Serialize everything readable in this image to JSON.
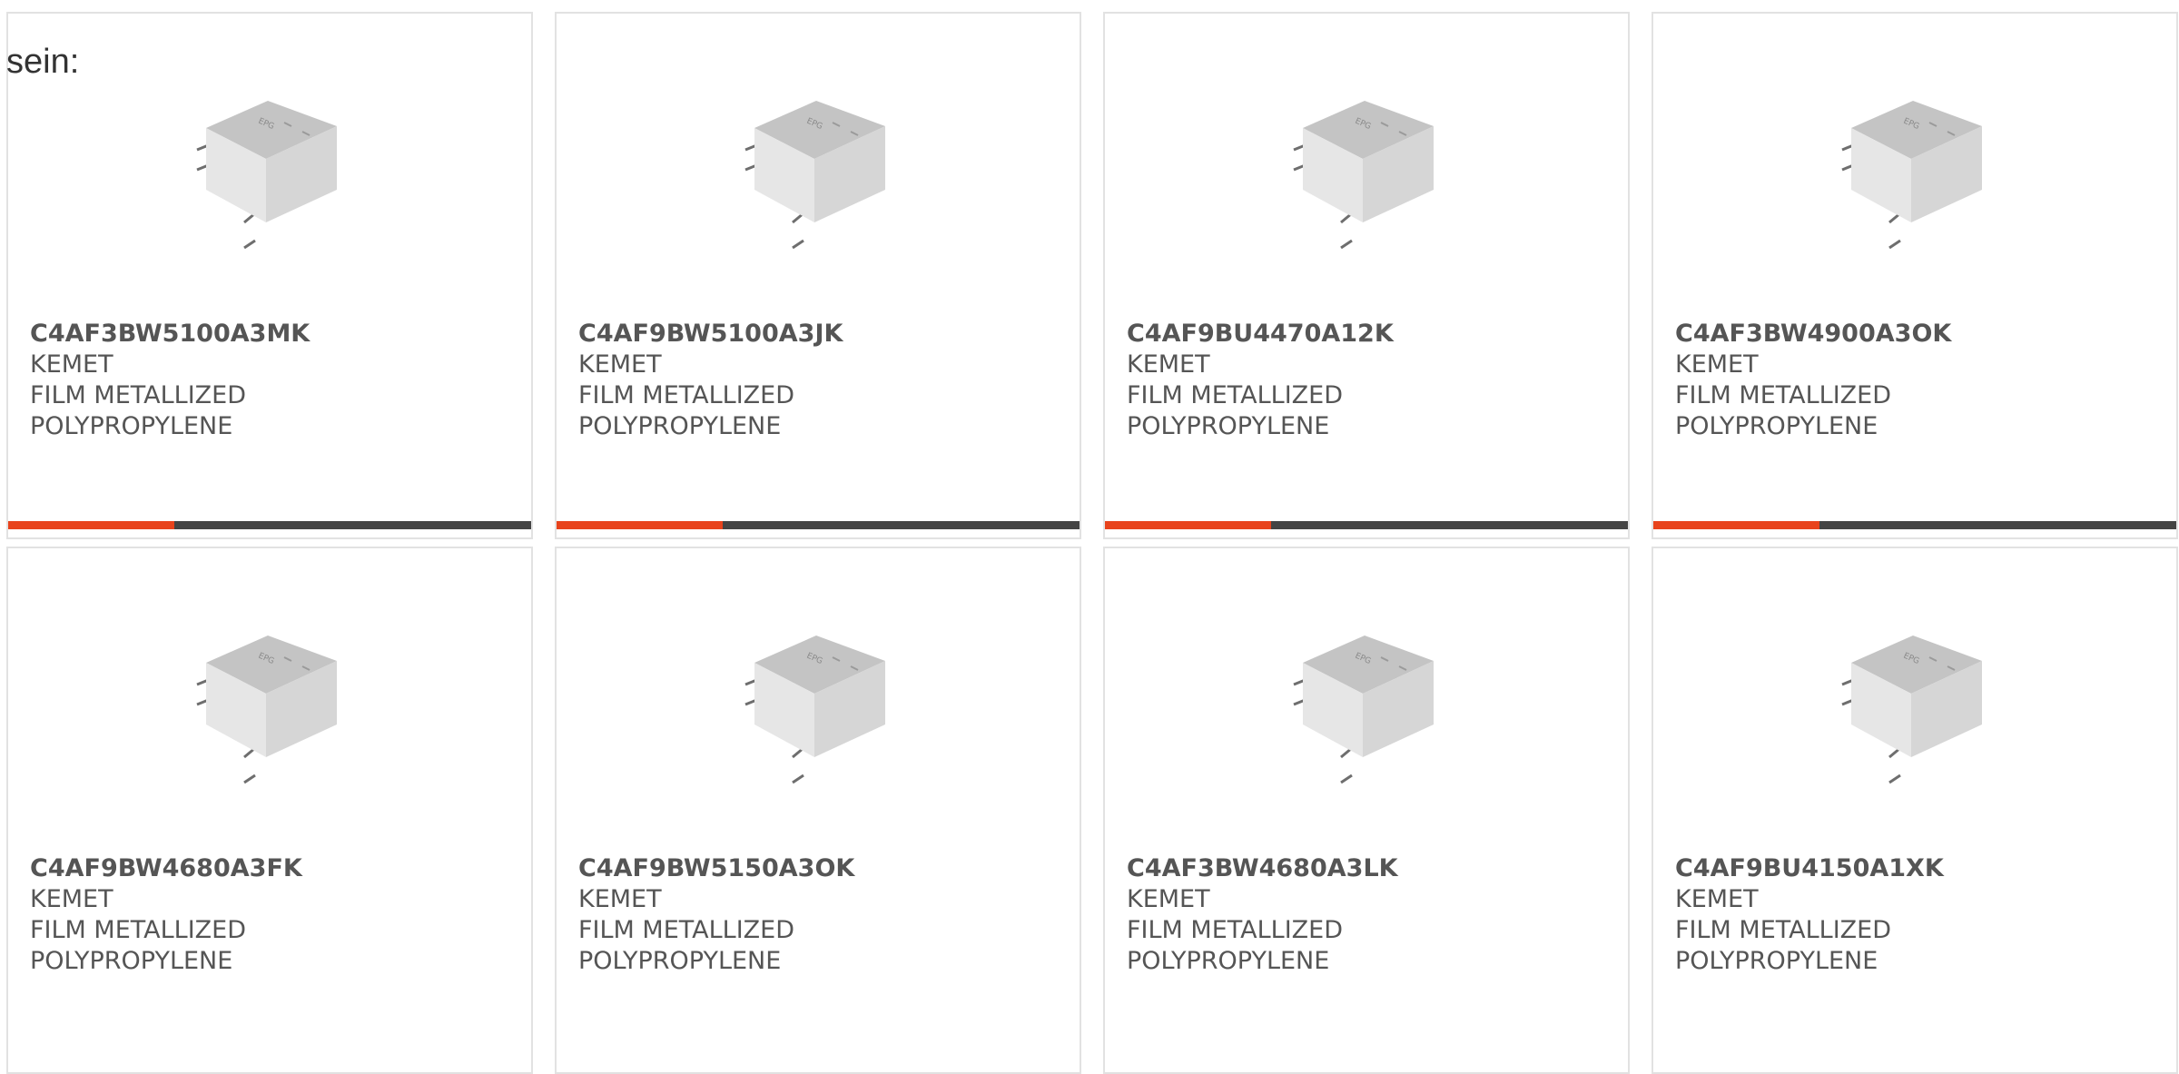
{
  "intro_text": "sein:",
  "colors": {
    "accent": "#e8431c",
    "bar_dark": "#444444",
    "border": "#e2e2e2",
    "text": "#555555"
  },
  "products": [
    {
      "part": "C4AF3BW5100A3MK",
      "maker": "KEMET",
      "desc1": "FILM METALLIZED",
      "desc2": "POLYPROPYLENE",
      "image_icon": "capacitor-image",
      "bar": true
    },
    {
      "part": "C4AF9BW5100A3JK",
      "maker": "KEMET",
      "desc1": "FILM METALLIZED",
      "desc2": "POLYPROPYLENE",
      "image_icon": "capacitor-image",
      "bar": true
    },
    {
      "part": "C4AF9BU4470A12K",
      "maker": "KEMET",
      "desc1": "FILM METALLIZED",
      "desc2": "POLYPROPYLENE",
      "image_icon": "capacitor-image",
      "bar": true
    },
    {
      "part": "C4AF3BW4900A3OK",
      "maker": "KEMET",
      "desc1": "FILM METALLIZED",
      "desc2": "POLYPROPYLENE",
      "image_icon": "capacitor-image",
      "bar": true
    },
    {
      "part": "C4AF9BW4680A3FK",
      "maker": "KEMET",
      "desc1": "FILM METALLIZED",
      "desc2": "POLYPROPYLENE",
      "image_icon": "capacitor-image",
      "bar": false
    },
    {
      "part": "C4AF9BW5150A3OK",
      "maker": "KEMET",
      "desc1": "FILM METALLIZED",
      "desc2": "POLYPROPYLENE",
      "image_icon": "capacitor-image",
      "bar": false
    },
    {
      "part": "C4AF3BW4680A3LK",
      "maker": "KEMET",
      "desc1": "FILM METALLIZED",
      "desc2": "POLYPROPYLENE",
      "image_icon": "capacitor-image",
      "bar": false
    },
    {
      "part": "C4AF9BU4150A1XK",
      "maker": "KEMET",
      "desc1": "FILM METALLIZED",
      "desc2": "POLYPROPYLENE",
      "image_icon": "capacitor-image",
      "bar": false
    }
  ]
}
